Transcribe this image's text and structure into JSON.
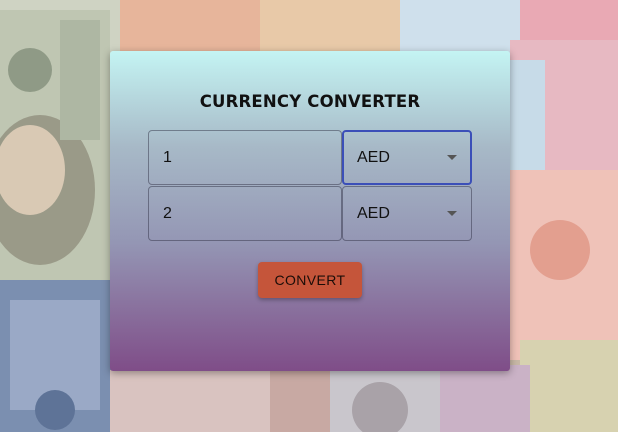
{
  "app": {
    "title": "CURRENCY CONVERTER"
  },
  "converter": {
    "from": {
      "amount": "1",
      "currency": "AED"
    },
    "to": {
      "amount": "2",
      "currency": "AED"
    },
    "convert_label": "CONVERT"
  },
  "colors": {
    "accent": "#3b4fb8",
    "button": "#c5553a",
    "card_top": "#c4f4f3",
    "card_bottom": "#7f4d88"
  },
  "icons": {
    "dropdown": "chevron-down-icon"
  }
}
